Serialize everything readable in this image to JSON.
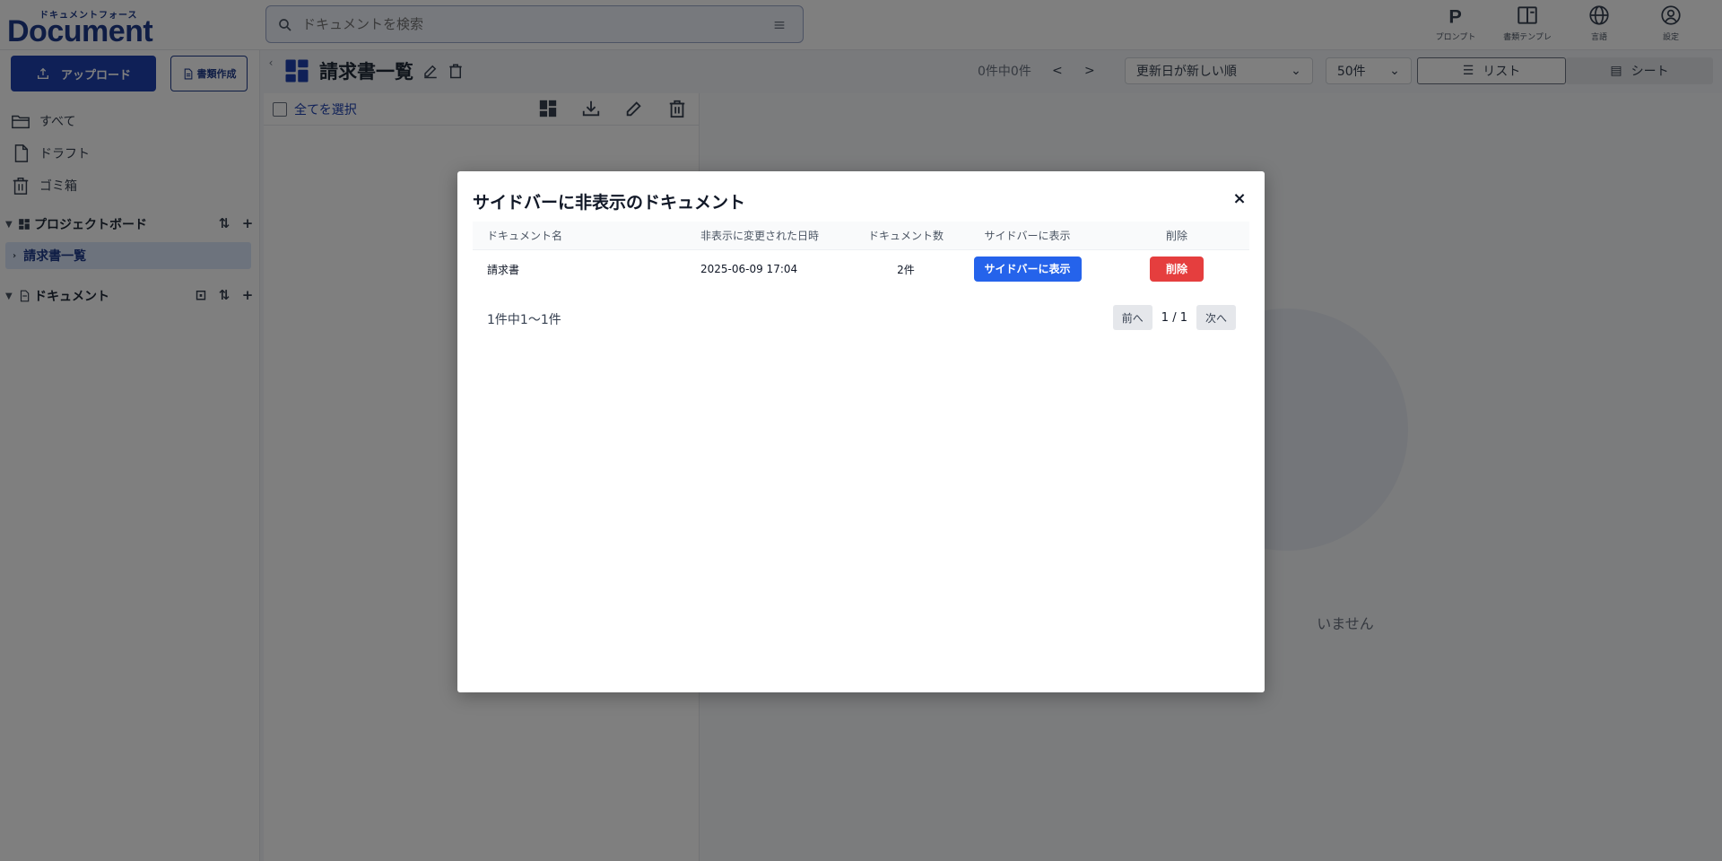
{
  "app": {
    "logo_kana": "ドキュメントフォース",
    "logo_name": "Document Force",
    "search_placeholder": "ドキュメントを検索"
  },
  "toolbar": {
    "prompt_label": "プロンプト",
    "template_label": "書類テンプレ",
    "language_label": "言語",
    "settings_label": "設定"
  },
  "sidebar": {
    "upload_label": "アップロード",
    "create_label": "書類作成",
    "nav": [
      {
        "label": "すべて",
        "icon": "folder-icon"
      },
      {
        "label": "ドラフト",
        "icon": "file-icon"
      },
      {
        "label": "ゴミ箱",
        "icon": "trash-icon"
      }
    ],
    "project_board_label": "プロジェクトボード",
    "board_items": [
      {
        "label": "請求書一覧"
      }
    ],
    "documents_label": "ドキュメント"
  },
  "main": {
    "title": "請求書一覧",
    "count_text": "0件中0件",
    "prev_glyph": "<",
    "next_glyph": ">",
    "sort_value": "更新日が新しい順",
    "page_size_value": "50件",
    "view_list_label": "リスト",
    "view_sheet_label": "シート",
    "select_all_label": "全てを選択",
    "empty_text": "いません"
  },
  "modal": {
    "title": "サイドバーに非表示のドキュメント",
    "close_glyph": "×",
    "columns": [
      "ドキュメント名",
      "非表示に変更された日時",
      "ドキュメント数",
      "サイドバーに表示",
      "削除"
    ],
    "rows": [
      {
        "name": "請求書",
        "hidden_at": "2025-06-09 17:04",
        "count": "2件",
        "show_label": "サイドバーに表示",
        "delete_label": "削除"
      }
    ],
    "summary": "1件中1〜1件",
    "prev_label": "前へ",
    "page_info": "1 / 1",
    "next_label": "次へ"
  },
  "colors": {
    "brand": "#1e3a8a",
    "primary_button": "#1e40af",
    "show_button": "#2563eb",
    "delete_button": "#e53e3e",
    "selected_item_bg": "#dbe7fb"
  }
}
